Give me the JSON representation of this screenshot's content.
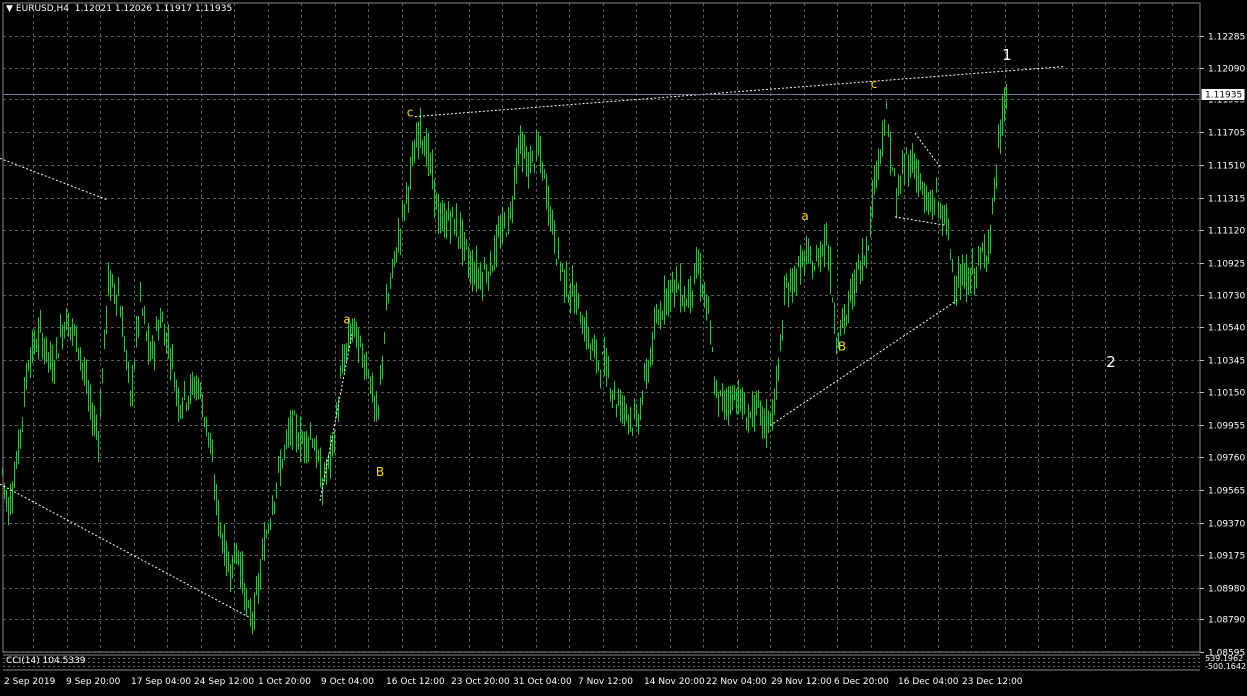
{
  "header": {
    "symbol_timeframe": "EURUSD,H4",
    "ohlc": "1.12021 1.12026 1.11917 1.11935",
    "menu_glyph": "▼"
  },
  "indicator": {
    "label": "CCI(14) 104.5339",
    "axis_labels": [
      "539.1962",
      "-500.1642"
    ]
  },
  "colors": {
    "background": "#000000",
    "grid": "#5a5a5a",
    "candle": "#3cb44b",
    "text": "#ffffff",
    "wave_label": "#ffd700",
    "bid_line": "#708090",
    "trend_line": "#ffffff"
  },
  "chart_data": {
    "type": "candlestick",
    "symbol": "EURUSD",
    "timeframe": "H4",
    "ylim": [
      1.08595,
      1.1248
    ],
    "grid": true,
    "y_ticks": [
      "1.12285",
      "1.12090",
      "1.11905",
      "1.11705",
      "1.11510",
      "1.11315",
      "1.11120",
      "1.10925",
      "1.10730",
      "1.10540",
      "1.10345",
      "1.10150",
      "1.09955",
      "1.09760",
      "1.09565",
      "1.09370",
      "1.09175",
      "1.08980",
      "1.08790",
      "1.08595"
    ],
    "x_ticks": [
      "2 Sep 2019",
      "9 Sep 20:00",
      "17 Sep 04:00",
      "24 Sep 12:00",
      "1 Oct 20:00",
      "9 Oct 04:00",
      "16 Oct 12:00",
      "23 Oct 20:00",
      "31 Oct 04:00",
      "7 Nov 12:00",
      "14 Nov 20:00",
      "22 Nov 04:00",
      "29 Nov 12:00",
      "6 Dec 20:00",
      "16 Dec 04:00",
      "23 Dec 12:00"
    ],
    "current_price": "1.11935",
    "price_path": [
      [
        0,
        1.0975
      ],
      [
        8,
        1.0945
      ],
      [
        18,
        1.098
      ],
      [
        28,
        1.1035
      ],
      [
        40,
        1.105
      ],
      [
        52,
        1.103
      ],
      [
        65,
        1.106
      ],
      [
        78,
        1.1045
      ],
      [
        90,
        1.1005
      ],
      [
        98,
        1.099
      ],
      [
        108,
        1.108
      ],
      [
        118,
        1.1075
      ],
      [
        125,
        1.104
      ],
      [
        130,
        1.101
      ],
      [
        140,
        1.107
      ],
      [
        150,
        1.1035
      ],
      [
        160,
        1.106
      ],
      [
        170,
        1.104
      ],
      [
        178,
        1.101
      ],
      [
        188,
        1.1015
      ],
      [
        198,
        1.102
      ],
      [
        208,
        1.099
      ],
      [
        218,
        1.094
      ],
      [
        228,
        1.091
      ],
      [
        238,
        1.092
      ],
      [
        248,
        1.088
      ],
      [
        255,
        1.0885
      ],
      [
        263,
        1.092
      ],
      [
        272,
        1.095
      ],
      [
        282,
        1.0975
      ],
      [
        292,
        1.0995
      ],
      [
        302,
        1.0985
      ],
      [
        312,
        1.099
      ],
      [
        322,
        1.096
      ],
      [
        332,
        1.098
      ],
      [
        342,
        1.103
      ],
      [
        352,
        1.1055
      ],
      [
        360,
        1.104
      ],
      [
        368,
        1.103
      ],
      [
        377,
        1.0995
      ],
      [
        385,
        1.106
      ],
      [
        393,
        1.109
      ],
      [
        402,
        1.112
      ],
      [
        410,
        1.1145
      ],
      [
        420,
        1.1175
      ],
      [
        430,
        1.115
      ],
      [
        440,
        1.1115
      ],
      [
        450,
        1.112
      ],
      [
        460,
        1.111
      ],
      [
        470,
        1.109
      ],
      [
        480,
        1.1085
      ],
      [
        490,
        1.109
      ],
      [
        500,
        1.111
      ],
      [
        510,
        1.112
      ],
      [
        518,
        1.1165
      ],
      [
        528,
        1.115
      ],
      [
        538,
        1.116
      ],
      [
        548,
        1.113
      ],
      [
        556,
        1.11
      ],
      [
        566,
        1.108
      ],
      [
        576,
        1.107
      ],
      [
        586,
        1.105
      ],
      [
        596,
        1.1035
      ],
      [
        606,
        1.103
      ],
      [
        616,
        1.101
      ],
      [
        626,
        1.1005
      ],
      [
        636,
        1.0995
      ],
      [
        646,
        1.1025
      ],
      [
        656,
        1.1055
      ],
      [
        666,
        1.1075
      ],
      [
        676,
        1.108
      ],
      [
        686,
        1.107
      ],
      [
        698,
        1.109
      ],
      [
        708,
        1.106
      ],
      [
        716,
        1.101
      ],
      [
        726,
        1.101
      ],
      [
        736,
        1.1015
      ],
      [
        746,
        1.1
      ],
      [
        756,
        1.1005
      ],
      [
        766,
        1.0995
      ],
      [
        775,
        1.101
      ],
      [
        785,
        1.1075
      ],
      [
        795,
        1.1085
      ],
      [
        805,
        1.1095
      ],
      [
        815,
        1.109
      ],
      [
        826,
        1.111
      ],
      [
        836,
        1.105
      ],
      [
        846,
        1.106
      ],
      [
        856,
        1.1085
      ],
      [
        866,
        1.11
      ],
      [
        876,
        1.115
      ],
      [
        886,
        1.118
      ],
      [
        896,
        1.113
      ],
      [
        906,
        1.1155
      ],
      [
        916,
        1.115
      ],
      [
        926,
        1.1125
      ],
      [
        936,
        1.113
      ],
      [
        946,
        1.1115
      ],
      [
        954,
        1.1085
      ],
      [
        962,
        1.108
      ],
      [
        972,
        1.1085
      ],
      [
        982,
        1.1095
      ],
      [
        990,
        1.111
      ],
      [
        998,
        1.116
      ],
      [
        1006,
        1.1195
      ]
    ],
    "annotations": [
      {
        "text": "a",
        "price": 1.1056,
        "x_index": 347
      },
      {
        "text": "B",
        "price": 1.0965,
        "x_index": 380
      },
      {
        "text": "c",
        "price": 1.118,
        "x_index": 410
      },
      {
        "text": "a",
        "price": 1.1118,
        "x_index": 805
      },
      {
        "text": "B",
        "price": 1.104,
        "x_index": 842
      },
      {
        "text": "c",
        "price": 1.1197,
        "x_index": 874
      },
      {
        "text": "1",
        "price": 1.1214,
        "x_index": 1007
      },
      {
        "text": "2",
        "price": 1.103,
        "x_index": 1111
      }
    ],
    "trend_lines": [
      {
        "from": [
          0,
          1.1155
        ],
        "to": [
          108,
          1.113
        ]
      },
      {
        "from": [
          0,
          1.096
        ],
        "to": [
          250,
          1.088
        ]
      },
      {
        "from": [
          320,
          1.095
        ],
        "to": [
          352,
          1.105
        ]
      },
      {
        "from": [
          415,
          1.118
        ],
        "to": [
          1065,
          1.121
        ]
      },
      {
        "from": [
          770,
          1.0995
        ],
        "to": [
          957,
          1.107
        ]
      },
      {
        "from": [
          915,
          1.117
        ],
        "to": [
          940,
          1.115
        ]
      },
      {
        "from": [
          895,
          1.112
        ],
        "to": [
          945,
          1.1115
        ]
      }
    ]
  }
}
